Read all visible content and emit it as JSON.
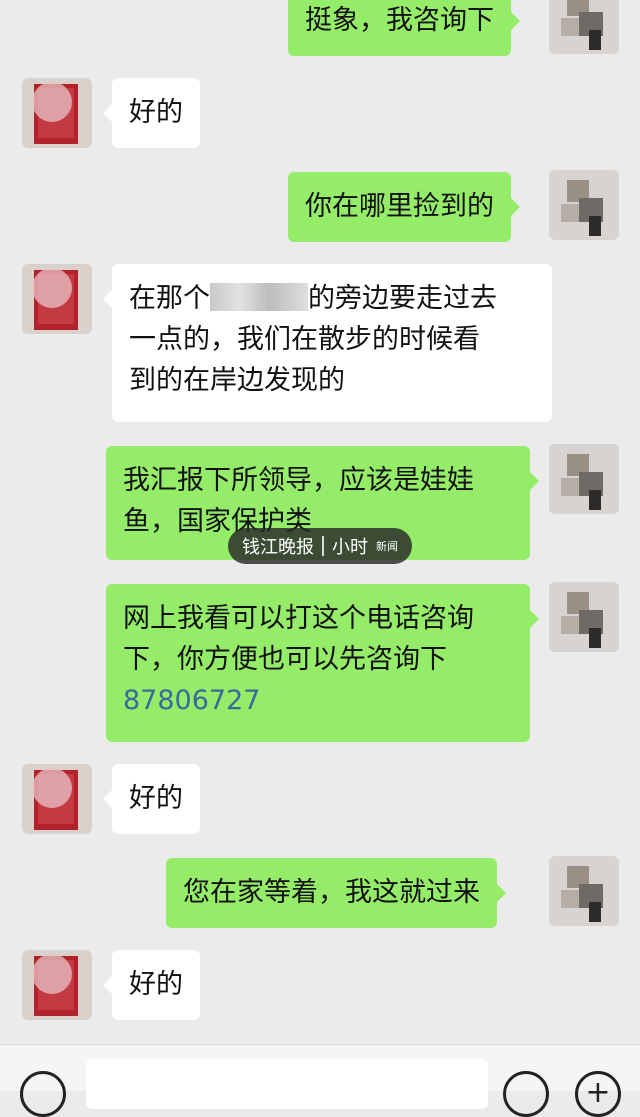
{
  "messages": [
    {
      "side": "right",
      "text": "挺象，我咨询下"
    },
    {
      "side": "left",
      "text": "好的"
    },
    {
      "side": "right",
      "text": "你在哪里捡到的"
    },
    {
      "side": "left",
      "line1_prefix": "在那个",
      "line1_suffix": "的旁边要走过去",
      "line2": "一点的，我们在散步的时候看",
      "line3": "到的在岸边发现的"
    },
    {
      "side": "right",
      "line1": "我汇报下所领导，应该是娃娃",
      "line2": "鱼，国家保护类"
    },
    {
      "side": "right",
      "line1": "网上我看可以打这个电话咨询",
      "line2": "下，你方便也可以先咨询下",
      "phone": "87806727"
    },
    {
      "side": "left",
      "text": "好的"
    },
    {
      "side": "right",
      "text": "您在家等着，我这就过来"
    },
    {
      "side": "left",
      "text": "好的"
    }
  ],
  "watermark": {
    "brand": "钱江晚报",
    "sub_brand": "小时",
    "sub_text": "新闻"
  },
  "input_bar": {
    "plus_symbol": "+"
  },
  "colors": {
    "background": "#ebebeb",
    "bubble_right": "#95ec69",
    "bubble_left": "#ffffff",
    "link": "#3a6a9c"
  }
}
